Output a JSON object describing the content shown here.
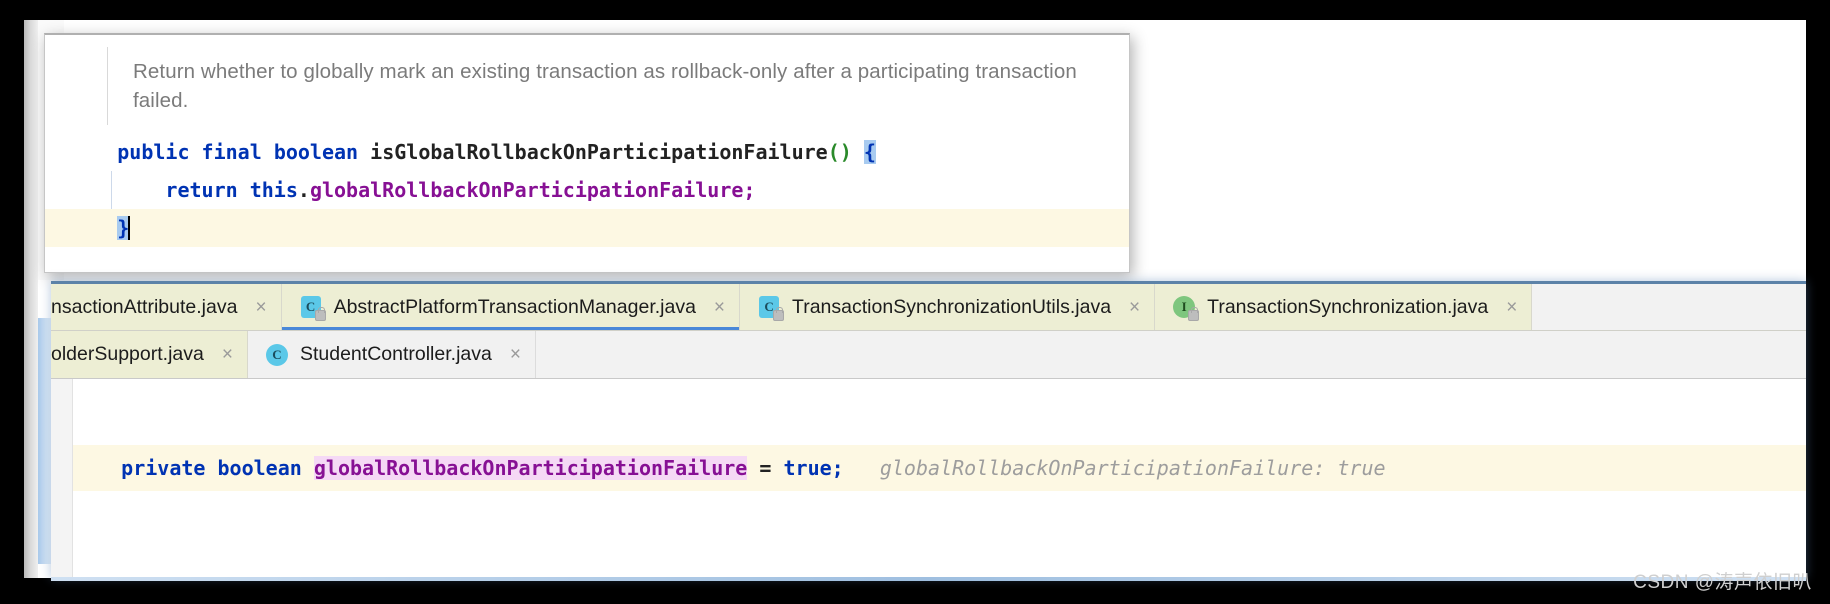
{
  "popup": {
    "doc_text": "Return whether to globally mark an existing transaction as rollback-only after a participating transaction failed.",
    "code": {
      "line1": {
        "kw_public": "public",
        "kw_final": "final",
        "kw_boolean": "boolean",
        "method_name": "isGlobalRollbackOnParticipationFailure",
        "parens": "()",
        "open_brace": "{"
      },
      "line2": {
        "kw_return": "return",
        "kw_this": "this",
        "dot": ".",
        "field": "globalRollbackOnParticipationFailure",
        "semicolon": ";"
      },
      "line3": {
        "close_brace": "}"
      }
    }
  },
  "tabs": {
    "row1": [
      {
        "label": "nsactionAttribute.java",
        "icon": "class-icon",
        "show_icon": false,
        "close": "×",
        "active": false,
        "clipped": true,
        "style": "file"
      },
      {
        "label": "AbstractPlatformTransactionManager.java",
        "icon": "class-icon",
        "show_icon": true,
        "close": "×",
        "active": true,
        "clipped": false,
        "style": "file"
      },
      {
        "label": "TransactionSynchronizationUtils.java",
        "icon": "class-icon",
        "show_icon": true,
        "close": "×",
        "active": false,
        "clipped": false,
        "style": "file"
      },
      {
        "label": "TransactionSynchronization.java",
        "icon": "interface-icon",
        "show_icon": true,
        "close": "×",
        "active": false,
        "clipped": false,
        "style": "file"
      }
    ],
    "row2": [
      {
        "label": "olderSupport.java",
        "icon": "class-icon",
        "show_icon": false,
        "close": "×",
        "active": false,
        "clipped": true,
        "style": "file"
      },
      {
        "label": "StudentController.java",
        "icon": "class-round-icon",
        "show_icon": true,
        "close": "×",
        "active": false,
        "clipped": false,
        "style": "plain"
      }
    ],
    "icon_glyphs": {
      "class": "C",
      "interface": "I"
    }
  },
  "editor": {
    "line": {
      "kw_private": "private",
      "kw_boolean": "boolean",
      "field": "globalRollbackOnParticipationFailure",
      "equals": "=",
      "value": "true",
      "semicolon": ";",
      "inline_hint": "globalRollbackOnParticipationFailure: true"
    }
  },
  "watermark": "CSDN @涛声依旧叭",
  "colors": {
    "keyword": "#0033b3",
    "field": "#871094",
    "paren": "#2a8a2a",
    "highlight_line": "#fdf8e3",
    "selection": "#a8cbf0",
    "field_hit": "#f5d9f5",
    "tab_active_underline": "#4a88d8",
    "tab_bg": "#edeed4",
    "hint": "#9d9d9d"
  }
}
